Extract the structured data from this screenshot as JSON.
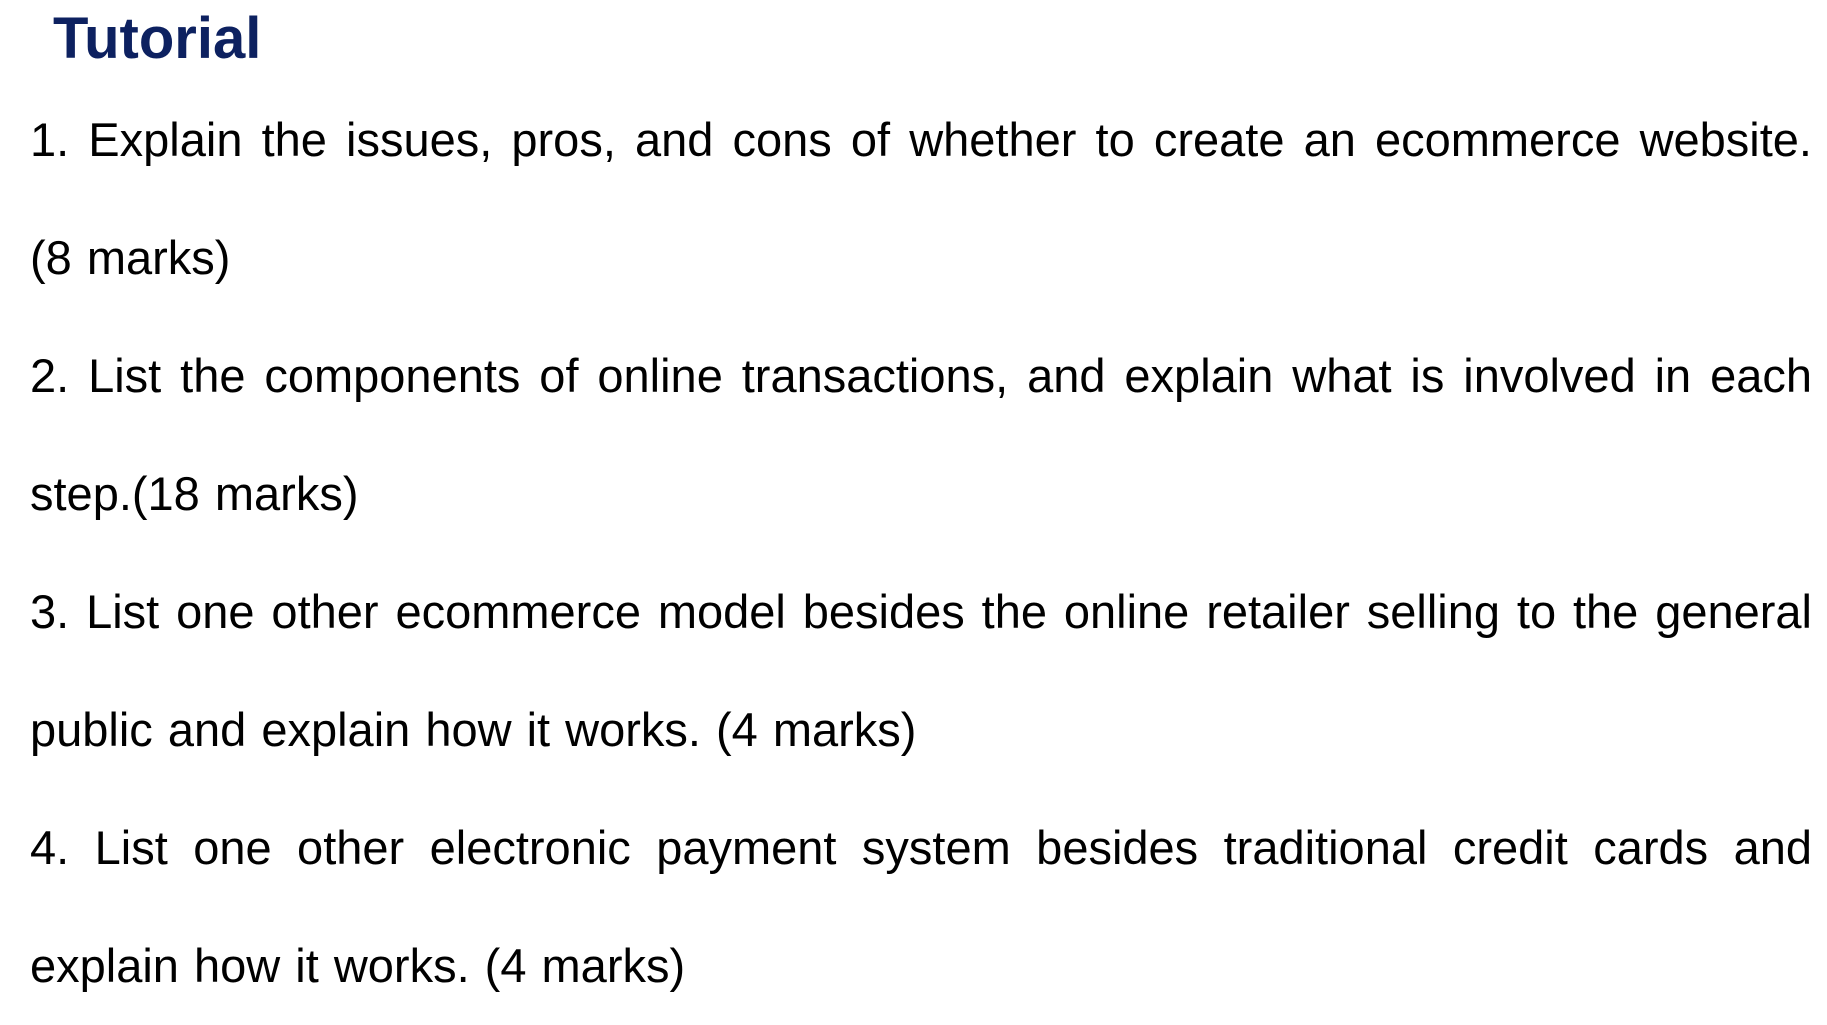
{
  "document": {
    "title": "Tutorial",
    "questions": [
      {
        "text": "1. Explain the issues, pros, and cons of whether to create an  ecommerce website. (8 marks)"
      },
      {
        "text": "2. List the components of online transactions, and explain what  is involved in each step.(18 marks)"
      },
      {
        "text": "3. List one other ecommerce model besides the online retailer  selling to the general public and explain how it works. (4 marks)"
      },
      {
        "text": "4. List one other electronic payment system besides traditional  credit cards and explain how it works. (4 marks)"
      }
    ]
  },
  "colors": {
    "title": "#0d2160",
    "body_text": "#000000",
    "background": "#ffffff"
  }
}
